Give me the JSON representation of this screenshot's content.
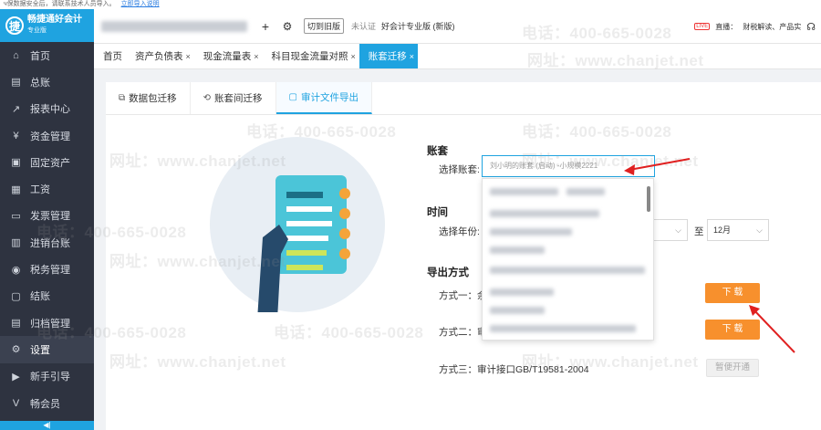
{
  "notice": {
    "text": "ч保数据安全后，请联系技术人员导入。",
    "link": "立即导入说明"
  },
  "app": {
    "name": "畅捷通好会计",
    "edition": "专业版",
    "logo_glyph": "捷"
  },
  "header": {
    "switch_label": "切到旧版",
    "cert_label": "未认证",
    "version_label": "好会计专业版 (新版)",
    "live_badge": "LIVE",
    "right_links": [
      "直播：",
      "财税解读、产品实"
    ]
  },
  "sidebar": {
    "items": [
      {
        "label": "首页",
        "icon": "home-icon",
        "glyph": "⌂"
      },
      {
        "label": "总账",
        "icon": "ledger-icon",
        "glyph": "▤"
      },
      {
        "label": "报表中心",
        "icon": "chart-icon",
        "glyph": "↗"
      },
      {
        "label": "资金管理",
        "icon": "money-icon",
        "glyph": "¥"
      },
      {
        "label": "固定资产",
        "icon": "asset-icon",
        "glyph": "▣"
      },
      {
        "label": "工资",
        "icon": "salary-icon",
        "glyph": "▦"
      },
      {
        "label": "发票管理",
        "icon": "invoice-icon",
        "glyph": "▭"
      },
      {
        "label": "进销台账",
        "icon": "inventory-icon",
        "glyph": "▥"
      },
      {
        "label": "税务管理",
        "icon": "tax-icon",
        "glyph": "◉"
      },
      {
        "label": "结账",
        "icon": "checkout-icon",
        "glyph": "▢"
      },
      {
        "label": "归档管理",
        "icon": "archive-icon",
        "glyph": "▤"
      },
      {
        "label": "设置",
        "icon": "gear-icon",
        "glyph": "⚙"
      },
      {
        "label": "新手引导",
        "icon": "guide-icon",
        "glyph": "▶"
      },
      {
        "label": "畅会员",
        "icon": "vip-icon",
        "glyph": "V"
      }
    ],
    "active_index": 11,
    "collapse_glyph": "◀|"
  },
  "tabs": [
    {
      "label": "首页",
      "closable": false
    },
    {
      "label": "资产负债表",
      "closable": true
    },
    {
      "label": "现金流量表",
      "closable": true
    },
    {
      "label": "科目现金流量对照",
      "closable": true
    },
    {
      "label": "账套迁移",
      "closable": true,
      "active": true
    }
  ],
  "subtabs": [
    {
      "label": "数据包迁移",
      "icon": "package-icon",
      "glyph": "⧉"
    },
    {
      "label": "账套间迁移",
      "icon": "transfer-icon",
      "glyph": "⟲"
    },
    {
      "label": "审计文件导出",
      "icon": "export-icon",
      "glyph": "▢",
      "active": true
    }
  ],
  "form": {
    "account_section": "账套",
    "account_label": "选择账套:",
    "account_placeholder": "刘小明的账套 (启动) -小规模2221",
    "time_section": "时间",
    "year_label": "选择年份:",
    "to_label": "至",
    "month_end": "12月",
    "export_section": "导出方式",
    "method1_label": "方式一：余",
    "method2_label": "方式二：审",
    "method3_label": "方式三：审计接口GB/T19581-2004",
    "download_label": "下 载",
    "activate_label": "暂便开通"
  },
  "watermark": {
    "phone": "电话：400-665-0028",
    "site": "网址：www.chanjet.net"
  },
  "colors": {
    "primary": "#1fa3e0",
    "download": "#f7902d",
    "sidebar": "#2e3340",
    "arrow": "#e02020"
  }
}
